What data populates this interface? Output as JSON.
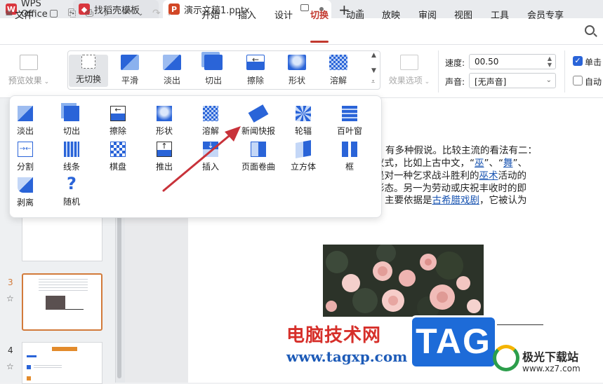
{
  "titlebar": {
    "tabs": [
      {
        "label": "WPS Office",
        "icon": "wps-logo-icon"
      },
      {
        "label": "找稻壳模板",
        "icon": "docer-icon"
      },
      {
        "label": "演示文稿1.pptx",
        "icon": "presentation-file-icon"
      }
    ]
  },
  "menubar": {
    "file_label": "文件",
    "items": [
      "开始",
      "插入",
      "设计",
      "切换",
      "动画",
      "放映",
      "审阅",
      "视图",
      "工具",
      "会员专享"
    ],
    "active": "切换"
  },
  "ribbon": {
    "preview_label": "预览效果",
    "gallery": [
      "无切换",
      "平滑",
      "淡出",
      "切出",
      "擦除",
      "形状",
      "溶解"
    ],
    "selected": "无切换",
    "effect_options_label": "效果选项",
    "speed_label": "速度:",
    "speed_value": "00.50",
    "sound_label": "声音:",
    "sound_value": "[无声音]",
    "on_click_label": "单击",
    "auto_label": "自动"
  },
  "dropdown": {
    "items": [
      "淡出",
      "切出",
      "擦除",
      "形状",
      "溶解",
      "新闻快报",
      "轮辐",
      "百叶窗",
      "分割",
      "线条",
      "棋盘",
      "推出",
      "插入",
      "页面卷曲",
      "立方体",
      "框",
      "剥离",
      "随机"
    ]
  },
  "slides": {
    "numbers": [
      "3",
      "4"
    ]
  },
  "slide_body": {
    "line1": "有多种假说。比较主流的看法有二：",
    "line2_a": "仪式，比如上古中文，“",
    "line2_link1": "巫",
    "line2_b": "”、“",
    "line2_link2": "舞",
    "line2_c": "”、",
    "line3_a": "是对一种乞求战斗胜利的",
    "line3_link": "巫术",
    "line3_b": "活动的",
    "line4": "形态。另一为劳动或庆祝丰收时的即",
    "line5_a": "主要依据是",
    "line5_link": "古希腊戏剧",
    "line5_b": "，它被认为"
  },
  "watermark": {
    "site_cn": "电脑技术网",
    "site_url": "www.tagxp.com",
    "tag": "TAG",
    "logo_cn": "极光下载站",
    "logo_url": "www.xz7.com"
  },
  "colors": {
    "accent": "#c2382e",
    "selection": "#d27a3a",
    "link": "#1a55b2",
    "icon_blue": "#2a64d8"
  }
}
